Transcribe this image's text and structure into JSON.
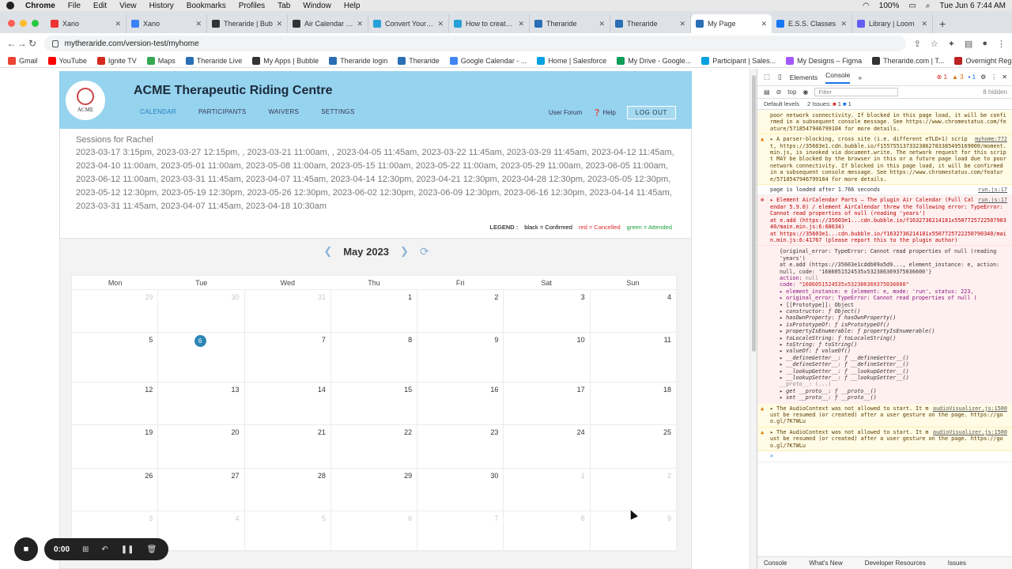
{
  "mac": {
    "app": "Chrome",
    "menus": [
      "File",
      "Edit",
      "View",
      "History",
      "Bookmarks",
      "Profiles",
      "Tab",
      "Window",
      "Help"
    ],
    "battery": "100%",
    "clock": "Tue Jun 6  7:44 AM"
  },
  "tabs": [
    {
      "title": "Xano",
      "color": "#e33"
    },
    {
      "title": "Xano",
      "color": "#3b82f6"
    },
    {
      "title": "Theraride | Bub",
      "color": "#333"
    },
    {
      "title": "Air Calendar (Fu",
      "color": "#333"
    },
    {
      "title": "Convert Your Bu",
      "color": "#27a0d8"
    },
    {
      "title": "How to create a",
      "color": "#27a0d8"
    },
    {
      "title": "Theraride",
      "color": "#2a6fb5"
    },
    {
      "title": "Theraride",
      "color": "#2a6fb5"
    },
    {
      "title": "My Page",
      "color": "#2a6fb5",
      "active": true
    },
    {
      "title": "E.S.S. Classes",
      "color": "#1877f2"
    },
    {
      "title": "Library | Loom",
      "color": "#625df5"
    }
  ],
  "address": {
    "url": "mytheraride.com/version-test/myhome"
  },
  "bookmarks": [
    {
      "label": "Gmail",
      "color": "#ea4335"
    },
    {
      "label": "YouTube",
      "color": "#ff0000"
    },
    {
      "label": "Ignite TV",
      "color": "#d52b1e"
    },
    {
      "label": "Maps",
      "color": "#34a853"
    },
    {
      "label": "Theraride Live",
      "color": "#2a6fb5"
    },
    {
      "label": "My Apps | Bubble",
      "color": "#333"
    },
    {
      "label": "Theraride login",
      "color": "#2a6fb5"
    },
    {
      "label": "Theraride",
      "color": "#2a6fb5"
    },
    {
      "label": "Google Calendar - ...",
      "color": "#4285f4"
    },
    {
      "label": "Home | Salesforce",
      "color": "#00a1e0"
    },
    {
      "label": "My Drive - Google...",
      "color": "#0f9d58"
    },
    {
      "label": "Participant | Sales...",
      "color": "#00a1e0"
    },
    {
      "label": "My Designs – Figma",
      "color": "#a259ff"
    },
    {
      "label": "Theraride.com | T...",
      "color": "#333"
    },
    {
      "label": "Overnight Registr...",
      "color": "#b22"
    }
  ],
  "app": {
    "org_title": "ACME Therapeutic Riding Centre",
    "logo_text": "ACME",
    "nav": [
      "CALENDAR",
      "PARTICIPANTS",
      "WAIVERS",
      "SETTINGS"
    ],
    "user_forum": "User Forum",
    "help": "Help",
    "logout": "LOG OUT"
  },
  "sessions": {
    "label": "Sessions for Rachel",
    "list": "2023-03-17 3:15pm, 2023-03-27 12:15pm, , 2023-03-21 11:00am, , 2023-04-05 11:45am, 2023-03-22 11:45am, 2023-03-29 11:45am, 2023-04-12 11:45am, 2023-04-10 11:00am, 2023-05-01 11:00am, 2023-05-08 11:00am, 2023-05-15 11:00am, 2023-05-22 11:00am, 2023-05-29 11:00am, 2023-06-05 11:00am, 2023-06-12 11:00am, 2023-03-31 11:45am, 2023-04-07 11:45am, 2023-04-14 12:30pm, 2023-04-21 12:30pm, 2023-04-28 12:30pm, 2023-05-05 12:30pm, 2023-05-12 12:30pm, 2023-05-19 12:30pm, 2023-05-26 12:30pm, 2023-06-02 12:30pm, 2023-06-09 12:30pm, 2023-06-16 12:30pm, 2023-04-14 11:45am, 2023-03-31 11:45am, 2023-04-07 11:45am, 2023-04-18 10:30am"
  },
  "legend": {
    "label": "LEGEND :",
    "confirmed": "black = Confirmed",
    "cancelled": "red = Cancelled",
    "attended": "green = Attended"
  },
  "calendar": {
    "month": "May 2023",
    "dow": [
      "Mon",
      "Tue",
      "Wed",
      "Thu",
      "Fri",
      "Sat",
      "Sun"
    ],
    "weeks": [
      [
        {
          "d": "29",
          "m": true
        },
        {
          "d": "30",
          "m": true
        },
        {
          "d": "31",
          "m": true
        },
        {
          "d": "1"
        },
        {
          "d": "2"
        },
        {
          "d": "3"
        },
        {
          "d": "4"
        }
      ],
      [
        {
          "d": "5"
        },
        {
          "d": "6",
          "today": true
        },
        {
          "d": "7"
        },
        {
          "d": "8"
        },
        {
          "d": "9"
        },
        {
          "d": "10"
        },
        {
          "d": "11"
        }
      ],
      [
        {
          "d": "12"
        },
        {
          "d": "13"
        },
        {
          "d": "14"
        },
        {
          "d": "15"
        },
        {
          "d": "16"
        },
        {
          "d": "17"
        },
        {
          "d": "18"
        }
      ],
      [
        {
          "d": "19"
        },
        {
          "d": "20"
        },
        {
          "d": "21"
        },
        {
          "d": "22"
        },
        {
          "d": "23"
        },
        {
          "d": "24"
        },
        {
          "d": "25"
        }
      ],
      [
        {
          "d": "26"
        },
        {
          "d": "27"
        },
        {
          "d": "28"
        },
        {
          "d": "29"
        },
        {
          "d": "30"
        },
        {
          "d": "1",
          "m": true
        },
        {
          "d": "2",
          "m": true
        }
      ],
      [
        {
          "d": "3",
          "m": true
        },
        {
          "d": "4",
          "m": true
        },
        {
          "d": "5",
          "m": true
        },
        {
          "d": "6",
          "m": true
        },
        {
          "d": "7",
          "m": true
        },
        {
          "d": "8",
          "m": true
        },
        {
          "d": "9",
          "m": true
        }
      ]
    ]
  },
  "loom": {
    "time": "0:00"
  },
  "devtools": {
    "tabs": [
      "Elements",
      "Console"
    ],
    "more": "»",
    "errors": "1",
    "warnings": "3",
    "infos": "1",
    "context": "top",
    "filter_placeholder": "Filter",
    "hidden": "8 hidden",
    "levels": "Default levels",
    "issues": "2 Issues:",
    "issues_err": "1",
    "issues_info": "1",
    "bottom_tabs": [
      "Console",
      "What's New",
      "Developer Resources",
      "Issues"
    ]
  },
  "console": {
    "m1": "poor network connectivity. If blocked in this page load, it will be confirmed in a subsequent console message. See https://www.chromestatus.com/feature/5718547946799104 for more details.",
    "m2_src": "myhome:772",
    "m2": "▸ A parser-blocking, cross site (i.e. different eTLD+1) script, https://35603e1.cdn.bubble.io/f1557551373323862783385495169000/moment.min.js, is invoked via document.write. The network request for this script MAY be blocked by the browser in this or a future page load due to poor network connectivity. If blocked in this page load, it will be confirmed in a subsequent console message. See https://www.chromestatus.com/feature/5718547946799104 for more details.",
    "m3_src": "run.js:17",
    "m3": "page is loaded after 1.766 seconds",
    "m4_src": "run.js:17",
    "m4": "▸ Element AirCalendar Parts – The plugin Air Calendar (Full Calendar 5.9.0) / element AirCalendar threw the following error: TypeError: Cannot read properties of null (reading 'years')\n  at e.add (https://35603e1...cdn.bubble.io/f1632736214181x550772572250790340/main.min.js:6:68634)\n  at https://35603e1...cdn.bubble.io/f1632736214181x5507725722250790340/main.min.js:6:41767 (please report this to the plugin author)",
    "t1": "{original_error: TypeError: Cannot read properties of null (reading 'years')",
    "t2": "  at e.add (https://35603e1cddb09a5d9..., element_instance: e, action: null, code: '1686051524535x532386369375036600'}",
    "t3k": "action:",
    "t3v": "null",
    "t4k": "code:",
    "t4v": "\"1686051524535x532386369375036600\"",
    "t5": "▸ element_instance: e {element: e, mode: 'run', status: 223,",
    "t6": "▸ original_error: TypeError: Cannot read properties of null (",
    "t7": "▾ [[Prototype]]: Object",
    "t8": "  ▸ constructor: ƒ Object()",
    "t9": "  ▸ hasOwnProperty: ƒ hasOwnProperty()",
    "t10": "  ▸ isPrototypeOf: ƒ isPrototypeOf()",
    "t11": "  ▸ propertyIsEnumerable: ƒ propertyIsEnumerable()",
    "t12": "  ▸ toLocaleString: ƒ toLocaleString()",
    "t13": "  ▸ toString: ƒ toString()",
    "t14": "  ▸ valueOf: ƒ valueOf()",
    "t15": "  ▸ __defineGetter__: ƒ __defineGetter__()",
    "t16": "  ▸ __defineSetter__: ƒ __defineSetter__()",
    "t17": "  ▸ __lookupGetter__: ƒ __lookupGetter__()",
    "t18": "  ▸ __lookupSetter__: ƒ __lookupSetter__()",
    "t19": "    __proto__: (...)",
    "t20": "  ▸ get __proto__: ƒ __proto__()",
    "t21": "  ▸ set __proto__: ƒ __proto__()",
    "m5_src": "audioVisualizer.js:1500",
    "m5": "▸ The AudioContext was not allowed to start. It must be resumed (or created) after a user gesture on the page. https://goo.gl/7K7WLu",
    "m6_src": "audioVisualizer.js:1500",
    "m6": "▸ The AudioContext was not allowed to start. It must be resumed (or created) after a user gesture on the page. https://goo.gl/7K7WLu",
    "prompt": ">"
  }
}
